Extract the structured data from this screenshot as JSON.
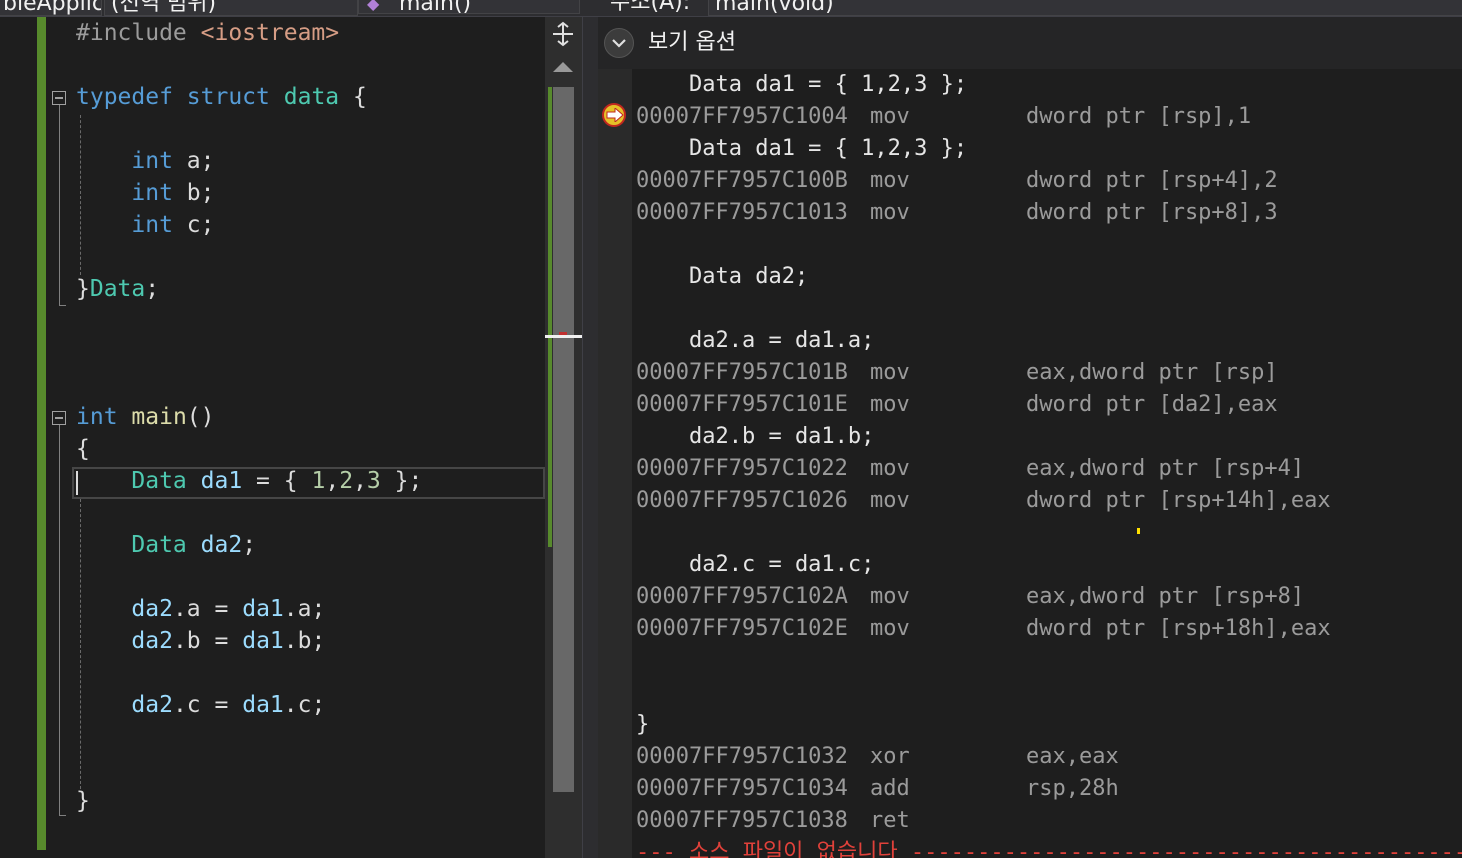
{
  "top_bar": {
    "project_combo": "bleApplic",
    "scope_combo": "(전역 범위)",
    "function_combo": "main()",
    "address_label": "주소(A):",
    "address_value": "main(void)"
  },
  "left_editor": {
    "lines": {
      "include_directive": "#include",
      "include_header": "<iostream>",
      "typedef_kw": "typedef",
      "struct_kw": "struct",
      "struct_name": "data",
      "open_brace": "{",
      "int_kw": "int",
      "field_a": "a",
      "field_b": "b",
      "field_c": "c",
      "semicolon": ";",
      "close_brace": "}",
      "typedef_name": "Data",
      "main_kw": "int",
      "main_name": "main",
      "main_parens": "()",
      "type_data": "Data",
      "var_da1": "da1",
      "var_da2": "da2",
      "equals": "=",
      "init_open": "{",
      "init_1": "1",
      "init_2": "2",
      "init_3": "3",
      "init_close": "};",
      "comma": ",",
      "dot": ".",
      "member_a": "a",
      "member_b": "b",
      "member_c": "c"
    }
  },
  "disassembly": {
    "view_options_label": "보기 옵션",
    "rows": [
      {
        "type": "source",
        "text": "    Data da1 = { 1,2,3 };"
      },
      {
        "type": "asm",
        "addr": "00007FF7957C1004",
        "op": "mov",
        "arg": "dword ptr [rsp],1",
        "current": true
      },
      {
        "type": "source",
        "text": "    Data da1 = { 1,2,3 };"
      },
      {
        "type": "asm",
        "addr": "00007FF7957C100B",
        "op": "mov",
        "arg": "dword ptr [rsp+4],2"
      },
      {
        "type": "asm",
        "addr": "00007FF7957C1013",
        "op": "mov",
        "arg": "dword ptr [rsp+8],3"
      },
      {
        "type": "blank"
      },
      {
        "type": "source",
        "text": "    Data da2;"
      },
      {
        "type": "blank"
      },
      {
        "type": "source",
        "text": "    da2.a = da1.a;"
      },
      {
        "type": "asm",
        "addr": "00007FF7957C101B",
        "op": "mov",
        "arg": "eax,dword ptr [rsp]"
      },
      {
        "type": "asm",
        "addr": "00007FF7957C101E",
        "op": "mov",
        "arg": "dword ptr [da2],eax"
      },
      {
        "type": "source",
        "text": "    da2.b = da1.b;"
      },
      {
        "type": "asm",
        "addr": "00007FF7957C1022",
        "op": "mov",
        "arg": "eax,dword ptr [rsp+4]"
      },
      {
        "type": "asm",
        "addr": "00007FF7957C1026",
        "op": "mov",
        "arg": "dword ptr [rsp+14h],eax"
      },
      {
        "type": "blank"
      },
      {
        "type": "source",
        "text": "    da2.c = da1.c;"
      },
      {
        "type": "asm",
        "addr": "00007FF7957C102A",
        "op": "mov",
        "arg": "eax,dword ptr [rsp+8]"
      },
      {
        "type": "asm",
        "addr": "00007FF7957C102E",
        "op": "mov",
        "arg": "dword ptr [rsp+18h],eax"
      },
      {
        "type": "blank"
      },
      {
        "type": "blank"
      },
      {
        "type": "source",
        "text": "}"
      },
      {
        "type": "asm",
        "addr": "00007FF7957C1032",
        "op": "xor",
        "arg": "eax,eax"
      },
      {
        "type": "asm",
        "addr": "00007FF7957C1034",
        "op": "add",
        "arg": "rsp,28h"
      },
      {
        "type": "asm",
        "addr": "00007FF7957C1038",
        "op": "ret",
        "arg": ""
      },
      {
        "type": "warn",
        "text": "--- 소스 파일이 없습니다 ---------------------------------------------"
      }
    ]
  },
  "colors": {
    "keyword": "#569cd6",
    "type": "#4ec9b0",
    "variable": "#9cdcfe",
    "number": "#b5cea8",
    "change_bar": "#578a2c",
    "warning": "#e0413a"
  }
}
